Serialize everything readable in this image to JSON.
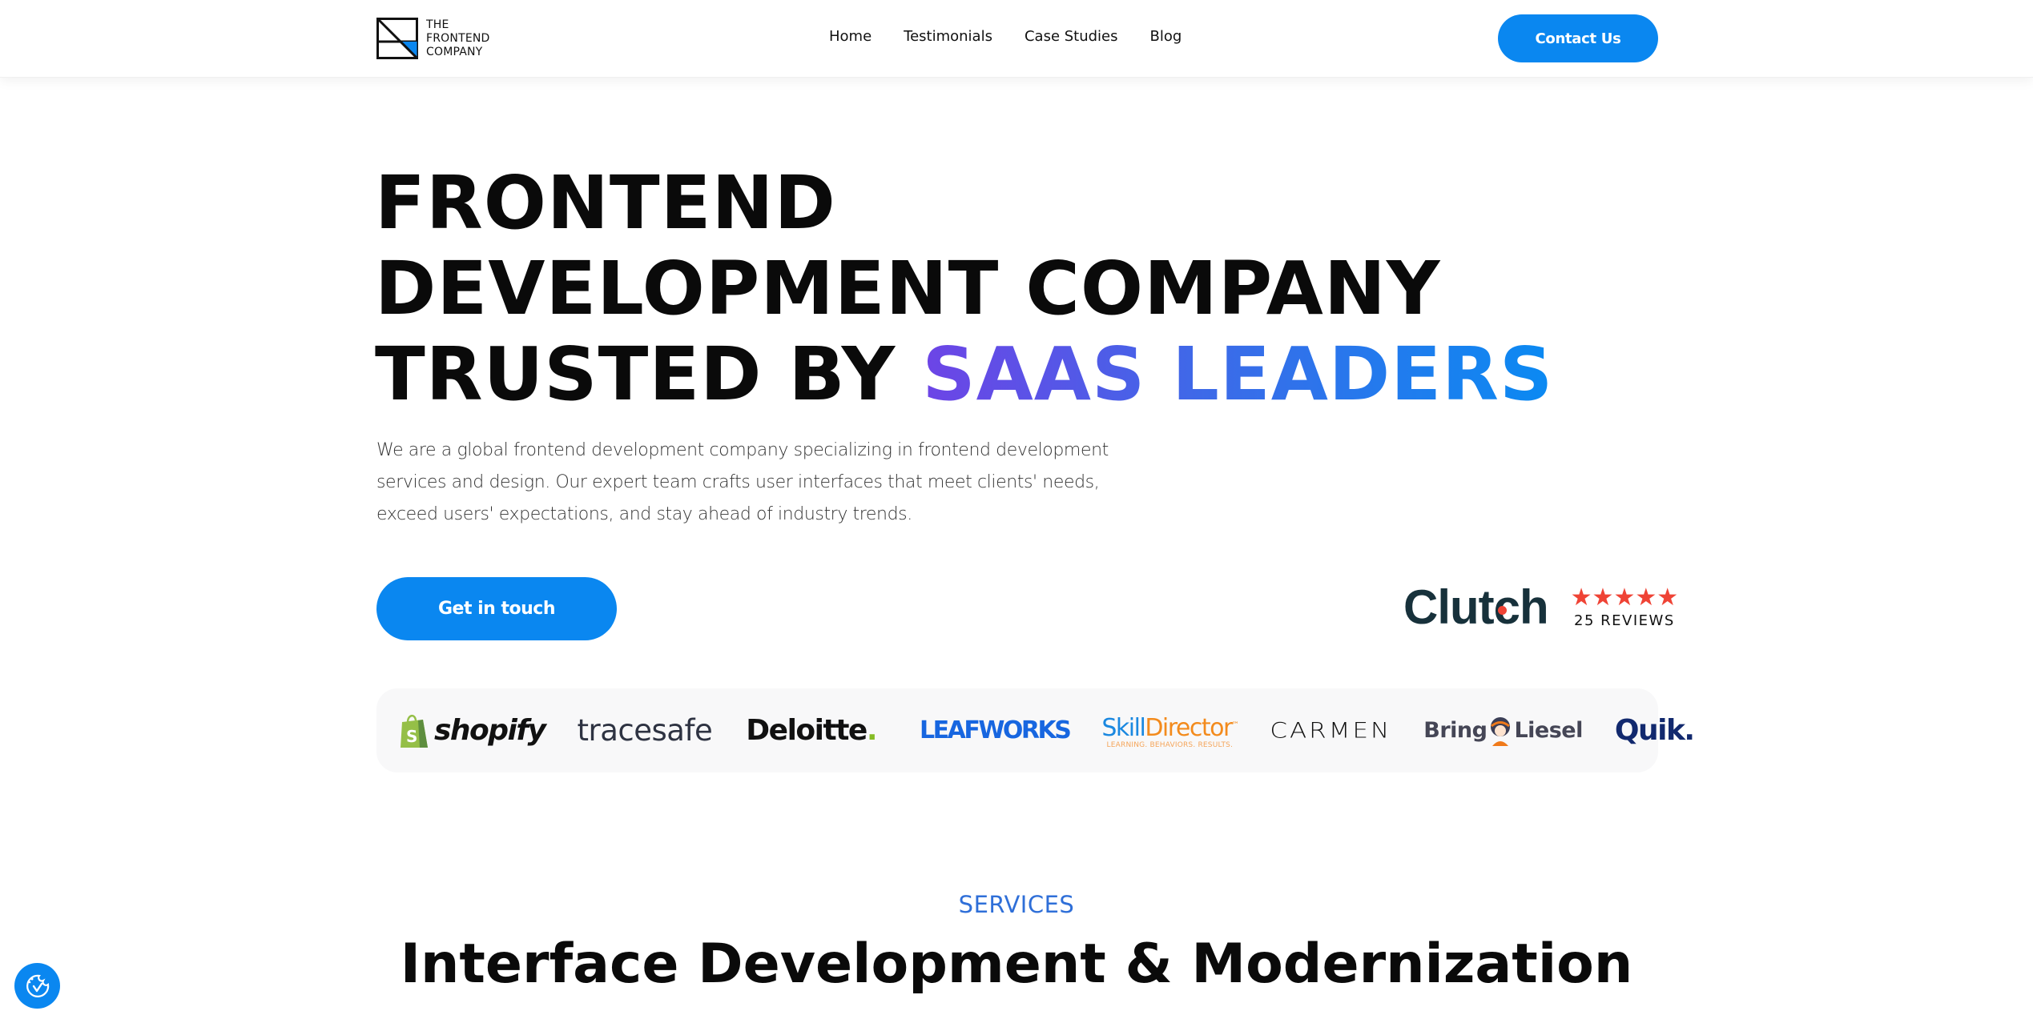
{
  "header": {
    "logo": {
      "line1": "THE",
      "line2": "FRONTEND",
      "line3": "COMPANY"
    },
    "nav": [
      {
        "label": "Home"
      },
      {
        "label": "Testimonials"
      },
      {
        "label": "Case Studies"
      },
      {
        "label": "Blog"
      }
    ],
    "contact_label": "Contact Us"
  },
  "hero": {
    "title_line1": "FRONTEND",
    "title_line2": "DEVELOPMENT COMPANY",
    "title_line3_plain": "TRUSTED BY ",
    "title_line3_highlight": "SAAS LEADERS",
    "description": "We are a global frontend development company specializing in frontend development services and design. Our expert team crafts user interfaces that meet clients' needs, exceed users' expectations, and stay ahead of industry trends.",
    "cta_label": "Get in touch"
  },
  "clutch": {
    "brand": "Clutch",
    "rating_stars": 5,
    "rating_max": 5,
    "stars": "★★★★★",
    "reviews": "25 REVIEWS"
  },
  "clients": {
    "shopify": "shopify",
    "tracesafe": "tracesafe",
    "deloitte": "Deloitte",
    "deloitte_dot": ".",
    "leafworks": "LEAFWORKS",
    "skilldirector_a": "Skill",
    "skilldirector_b": "Director",
    "skilldirector_tm": "™",
    "skilldirector_tagline": "LEARNING. BEHAVIORS. RESULTS.",
    "carmen": "CARMEN",
    "bring": "Bring",
    "liesel": "Liesel",
    "quik": "Quik."
  },
  "services": {
    "label": "SERVICES",
    "title": "Interface Development & Modernization"
  },
  "colors": {
    "accent": "#0a87f0",
    "gradient_start": "#6d44e6",
    "gradient_end": "#0a8af2",
    "clutch_red": "#ef4335",
    "services_label": "#2f6fd8"
  },
  "widgets": {
    "cookie_icon": "cookie-consent-icon"
  }
}
